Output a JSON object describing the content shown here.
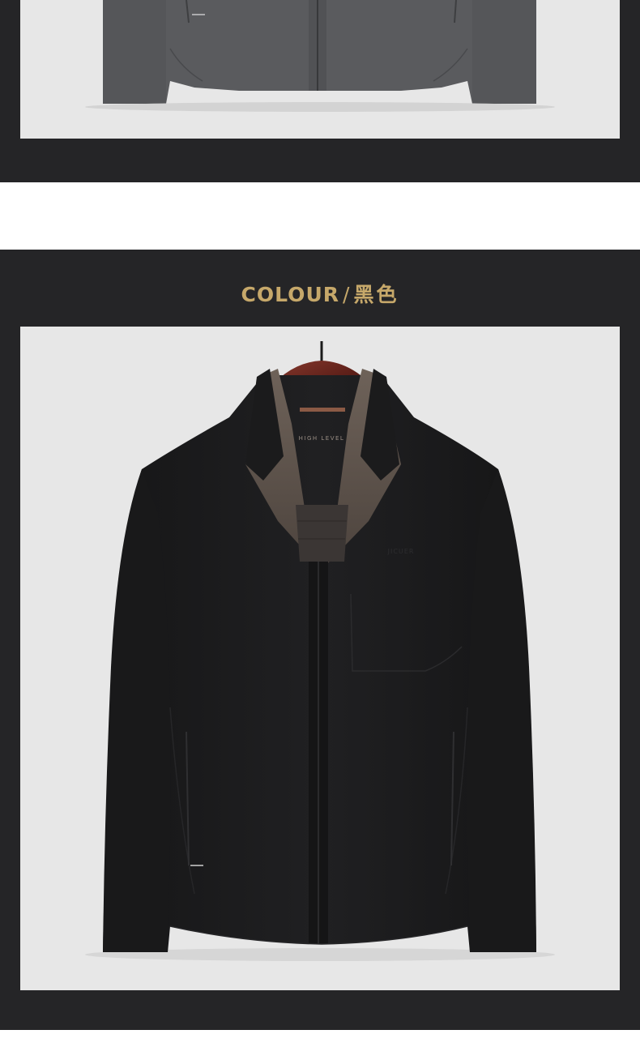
{
  "colour_section": {
    "label_en": "COLOUR",
    "separator": "/",
    "label_cn": "黑色"
  },
  "jacket_text": {
    "chest_logo": "JICUER",
    "lining_text": "HIGH LEVEL"
  },
  "colors": {
    "panel_bg": "#252527",
    "photo_bg": "#e7e7e7",
    "heading_gold": "#c6a86a",
    "jacket_grey": "#5a5b5e",
    "jacket_black": "#1c1c1d",
    "lining_taupe": "#8a7a6e",
    "hanger_wood": "#6b2a22"
  }
}
